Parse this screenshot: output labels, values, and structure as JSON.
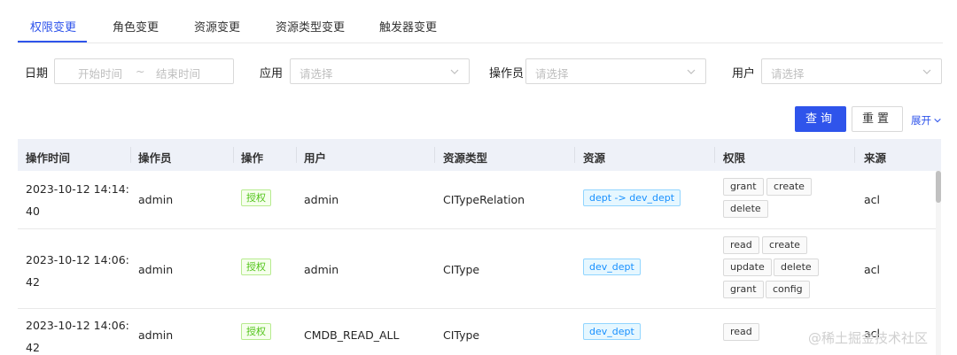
{
  "tabs": [
    {
      "label": "权限变更",
      "active": true
    },
    {
      "label": "角色变更"
    },
    {
      "label": "资源变更"
    },
    {
      "label": "资源类型变更"
    },
    {
      "label": "触发器变更"
    }
  ],
  "filters": {
    "date": {
      "label": "日期",
      "start_placeholder": "开始时间",
      "separator": "~",
      "end_placeholder": "结束时间"
    },
    "app": {
      "label": "应用",
      "placeholder": "请选择"
    },
    "operator": {
      "label": "操作员",
      "placeholder": "请选择"
    },
    "user": {
      "label": "用户",
      "placeholder": "请选择"
    }
  },
  "actions": {
    "query": "查询",
    "reset": "重置",
    "expand": "展开"
  },
  "table": {
    "columns": [
      "操作时间",
      "操作员",
      "操作",
      "用户",
      "资源类型",
      "资源",
      "权限",
      "来源"
    ],
    "rows": [
      {
        "time_line1": "2023-10-12 14:14:",
        "time_line2": "40",
        "operator": "admin",
        "action": "授权",
        "user": "admin",
        "resource_type": "CITypeRelation",
        "resource": "dept -> dev_dept",
        "permissions": [
          "grant",
          "create",
          "delete"
        ],
        "source": "acl"
      },
      {
        "time_line1": "2023-10-12 14:06:",
        "time_line2": "42",
        "operator": "admin",
        "action": "授权",
        "user": "admin",
        "resource_type": "CIType",
        "resource": "dev_dept",
        "permissions": [
          "read",
          "create",
          "update",
          "delete",
          "grant",
          "config"
        ],
        "source": "acl"
      },
      {
        "time_line1": "2023-10-12 14:06:",
        "time_line2": "42",
        "operator": "admin",
        "action": "授权",
        "user": "CMDB_READ_ALL",
        "resource_type": "CIType",
        "resource": "dev_dept",
        "permissions": [
          "read"
        ],
        "source": "acl"
      }
    ]
  },
  "watermark": "@稀土掘金技术社区",
  "colors": {
    "primary": "#2f54eb",
    "success": "#52c41a",
    "info": "#1890ff",
    "header_bg": "#eef1f8"
  },
  "icons": [
    "chevron-down-icon"
  ]
}
